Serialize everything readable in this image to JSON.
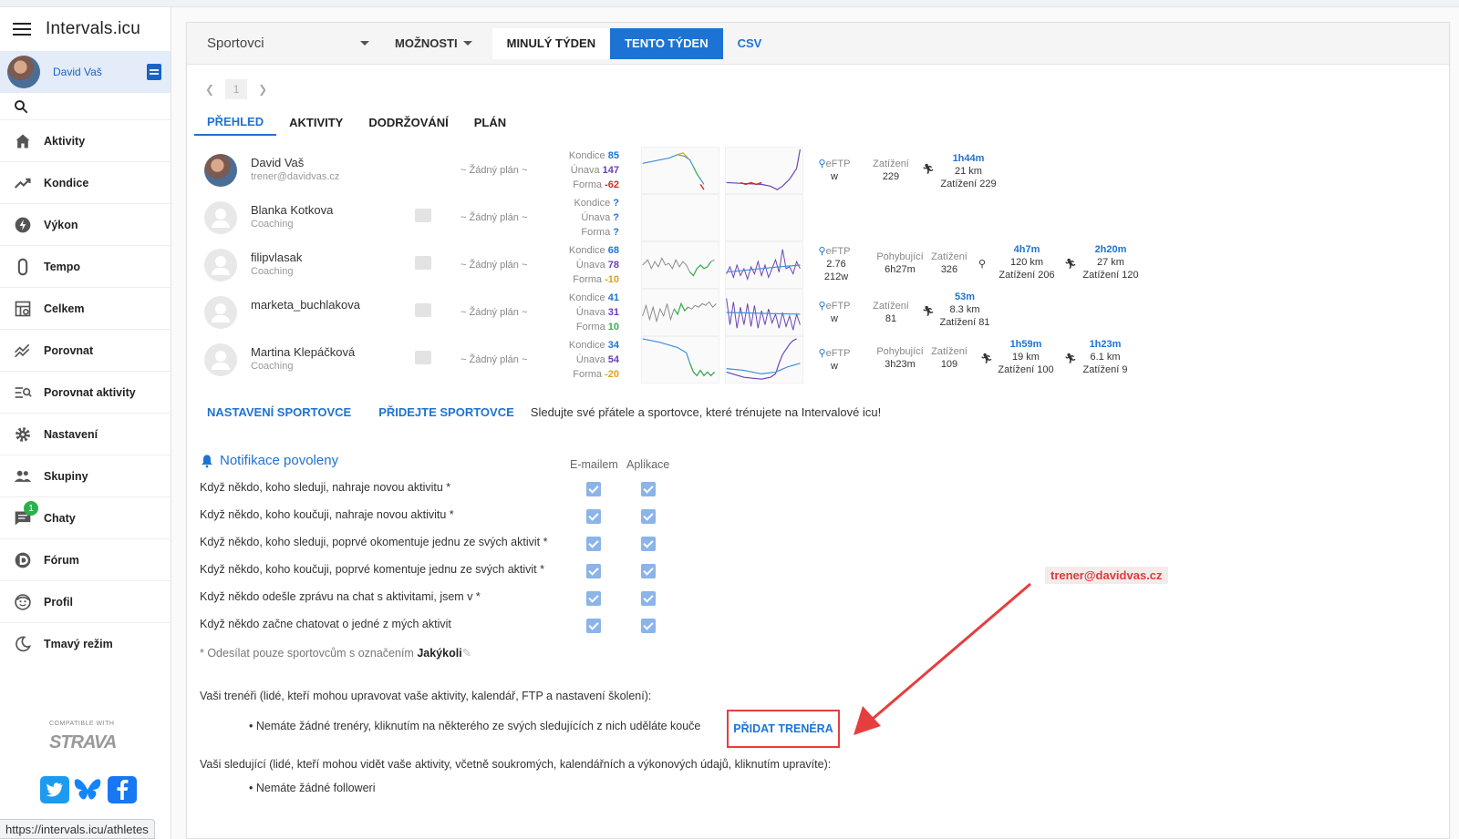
{
  "app": {
    "title": "Intervals.icu",
    "user_name": "David Vaš"
  },
  "sidebar": {
    "items": [
      {
        "label": "Aktivity",
        "icon": "home-icon"
      },
      {
        "label": "Kondice",
        "icon": "trending-icon"
      },
      {
        "label": "Výkon",
        "icon": "bolt-icon"
      },
      {
        "label": "Tempo",
        "icon": "stopwatch-icon"
      },
      {
        "label": "Celkem",
        "icon": "totals-icon"
      },
      {
        "label": "Porovnat",
        "icon": "compare-icon"
      },
      {
        "label": "Porovnat aktivity",
        "icon": "compare-activities-icon"
      },
      {
        "label": "Nastavení",
        "icon": "gear-icon"
      },
      {
        "label": "Skupiny",
        "icon": "group-icon"
      },
      {
        "label": "Chaty",
        "icon": "chat-icon",
        "badge": "1"
      },
      {
        "label": "Fórum",
        "icon": "forum-icon"
      },
      {
        "label": "Profil",
        "icon": "profile-icon"
      },
      {
        "label": "Tmavý režim",
        "icon": "moon-icon"
      }
    ],
    "compatible_with": "COMPATIBLE WITH",
    "strava": "STRAVA",
    "status_url": "https://intervals.icu/athletes"
  },
  "toolbar": {
    "sport_select": "Sportovci",
    "options": "MOŽNOSTI",
    "last_week": "MINULÝ TÝDEN",
    "this_week": "TENTO TÝDEN",
    "csv": "CSV"
  },
  "pager": {
    "page": "1"
  },
  "tabs": [
    "PŘEHLED",
    "AKTIVITY",
    "DODRŽOVÁNÍ",
    "PLÁN"
  ],
  "labels": {
    "kondice": "Kondice",
    "unava": "Únava",
    "forma": "Forma",
    "eftp": "eFTP",
    "pohybujici": "Pohybující",
    "zatizeni": "Zatížení",
    "no_plan": "~ Žádný plán ~"
  },
  "athletes": [
    {
      "name": "David Vaš",
      "sub": "trener@davidvas.cz",
      "kondice": "85",
      "unava": "147",
      "forma": "-62",
      "eftp": "w",
      "moving": "",
      "load": "229",
      "acts": [
        {
          "dur": "1h44m",
          "dist": "21 km",
          "load": "Zatížení 229",
          "sport": "run"
        }
      ]
    },
    {
      "name": "Blanka Kotkova",
      "sub": "Coaching",
      "kondice": "?",
      "unava": "?",
      "forma": "?",
      "eftp": "",
      "moving": "",
      "load": "",
      "acts": []
    },
    {
      "name": "filipvlasak",
      "sub": "Coaching",
      "kondice": "68",
      "unava": "78",
      "forma": "-10",
      "eftp": "2.76 212w",
      "moving": "6h27m",
      "load": "326",
      "acts": [
        {
          "dur": "4h7m",
          "dist": "120 km",
          "load": "Zatížení 206",
          "sport": "bike"
        },
        {
          "dur": "2h20m",
          "dist": "27 km",
          "load": "Zatížení 120",
          "sport": "run"
        }
      ]
    },
    {
      "name": "marketa_buchlakova",
      "sub": "",
      "kondice": "41",
      "unava": "31",
      "forma": "10",
      "eftp": "w",
      "moving": "",
      "load": "81",
      "acts": [
        {
          "dur": "53m",
          "dist": "8.3 km",
          "load": "Zatížení 81",
          "sport": "run"
        }
      ]
    },
    {
      "name": "Martina Klepáčková",
      "sub": "Coaching",
      "kondice": "34",
      "unava": "54",
      "forma": "-20",
      "eftp": "w",
      "moving": "3h23m",
      "load": "109",
      "acts": [
        {
          "dur": "1h59m",
          "dist": "19 km",
          "load": "Zatížení 100",
          "sport": "run"
        },
        {
          "dur": "1h23m",
          "dist": "6.1 km",
          "load": "Zatížení 9",
          "sport": "run"
        }
      ]
    }
  ],
  "links": {
    "settings": "NASTAVENÍ SPORTOVCE",
    "add": "PŘIDEJTE SPORTOVCE",
    "follow_text": "Sledujte své přátele a sportovce, které trénujete na Intervalové icu!"
  },
  "notifications": {
    "title": "Notifikace povoleny",
    "col_email": "E-mailem",
    "col_app": "Aplikace",
    "rows": [
      "Když někdo, koho sleduji, nahraje novou aktivitu *",
      "Když někdo, koho koučuji, nahraje novou aktivitu *",
      "Když někdo, koho sleduji, poprvé okomentuje jednu ze svých aktivit *",
      "Když někdo, koho koučuji, poprvé komentuje jednu ze svých aktivit *",
      "Když někdo odešle zprávu na chat s aktivitami, jsem v *",
      "Když někdo začne chatovat o jedné z mých aktivit"
    ],
    "note_prefix": "* Odesílat pouze sportovcům s označením",
    "note_value": "Jakýkoli"
  },
  "coaches": {
    "title": "Vaši trenéři (lidé, kteří mohou upravovat vaše aktivity, kalendář, FTP a nastavení školení):",
    "none": "Nemáte žádné trenéry, kliknutím na některého ze svých sledujících z nich uděláte kouče",
    "add_button": "PŘIDAT TRENÉRA"
  },
  "followers": {
    "title": "Vaši sledující (lidé, kteří mohou vidět vaše aktivity, včetně soukromých, kalendářních a výkonových údajů, kliknutím upravíte):",
    "none": "Nemáte žádné followeri"
  },
  "annotation": {
    "email": "trener@davidvas.cz",
    "color": "#e53e3e"
  }
}
